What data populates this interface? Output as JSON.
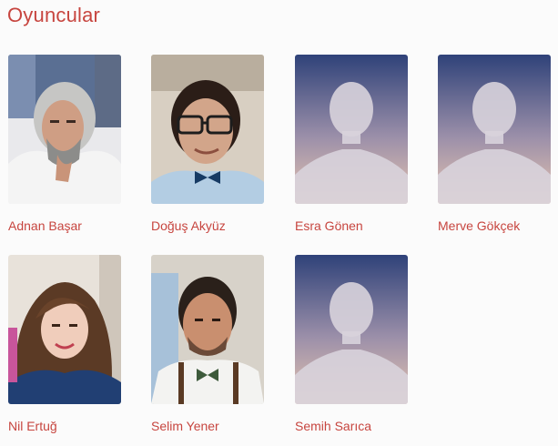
{
  "section": {
    "title": "Oyuncular"
  },
  "cast": [
    {
      "name": "Adnan Başar",
      "photo": "portrait-photo"
    },
    {
      "name": "Doğuş Akyüz",
      "photo": "portrait-photo"
    },
    {
      "name": "Esra Gönen",
      "photo": "placeholder-silhouette"
    },
    {
      "name": "Merve Gökçek",
      "photo": "placeholder-silhouette"
    },
    {
      "name": "Nil Ertuğ",
      "photo": "portrait-photo"
    },
    {
      "name": "Selim Yener",
      "photo": "portrait-photo"
    },
    {
      "name": "Semih Sarıca",
      "photo": "placeholder-silhouette"
    }
  ],
  "colors": {
    "accent": "#c7453f",
    "background": "#fbfbfb"
  }
}
